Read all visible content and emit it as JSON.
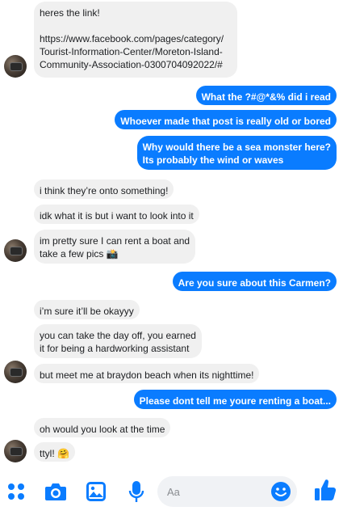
{
  "messages": [
    {
      "side": "in",
      "text": "heres the link!\n\nhttps://www.facebook.com/pages/category/\nTourist-Information-Center/Moreton-Island-\nCommunity-Association-0300704092022/#"
    },
    {
      "side": "out",
      "text": "What the ?#@*&% did i read"
    },
    {
      "side": "out",
      "text": "Whoever made that post is really old or bored"
    },
    {
      "side": "out",
      "text": "Why would there be a sea monster here?\nIts probably the wind or waves"
    },
    {
      "side": "in",
      "text": "i think they’re onto something!"
    },
    {
      "side": "in",
      "text": "idk what it is but i want to look into it"
    },
    {
      "side": "in",
      "text": "im pretty sure I can rent a boat and\ntake a few pics 📸"
    },
    {
      "side": "out",
      "text": "Are you sure about this Carmen?"
    },
    {
      "side": "in",
      "text": "i’m sure it’ll be okayyy"
    },
    {
      "side": "in",
      "text": "you can take the day off, you earned\nit for being a hardworking assistant"
    },
    {
      "side": "in",
      "text": "but meet me at braydon beach when its nighttime!"
    },
    {
      "side": "out",
      "text": "Please dont tell me youre renting a boat..."
    },
    {
      "side": "in",
      "text": "oh would you look at the time"
    },
    {
      "side": "in",
      "text": "ttyl! 🤗"
    }
  ],
  "composer": {
    "placeholder": "Aa",
    "icons": [
      "apps-icon",
      "camera-icon",
      "gallery-icon",
      "microphone-icon",
      "emoji-icon",
      "thumbs-up-icon"
    ]
  },
  "colors": {
    "accent": "#0a7cff",
    "incoming_bubble": "#f0f0f0",
    "outgoing_text": "#ffffff"
  }
}
